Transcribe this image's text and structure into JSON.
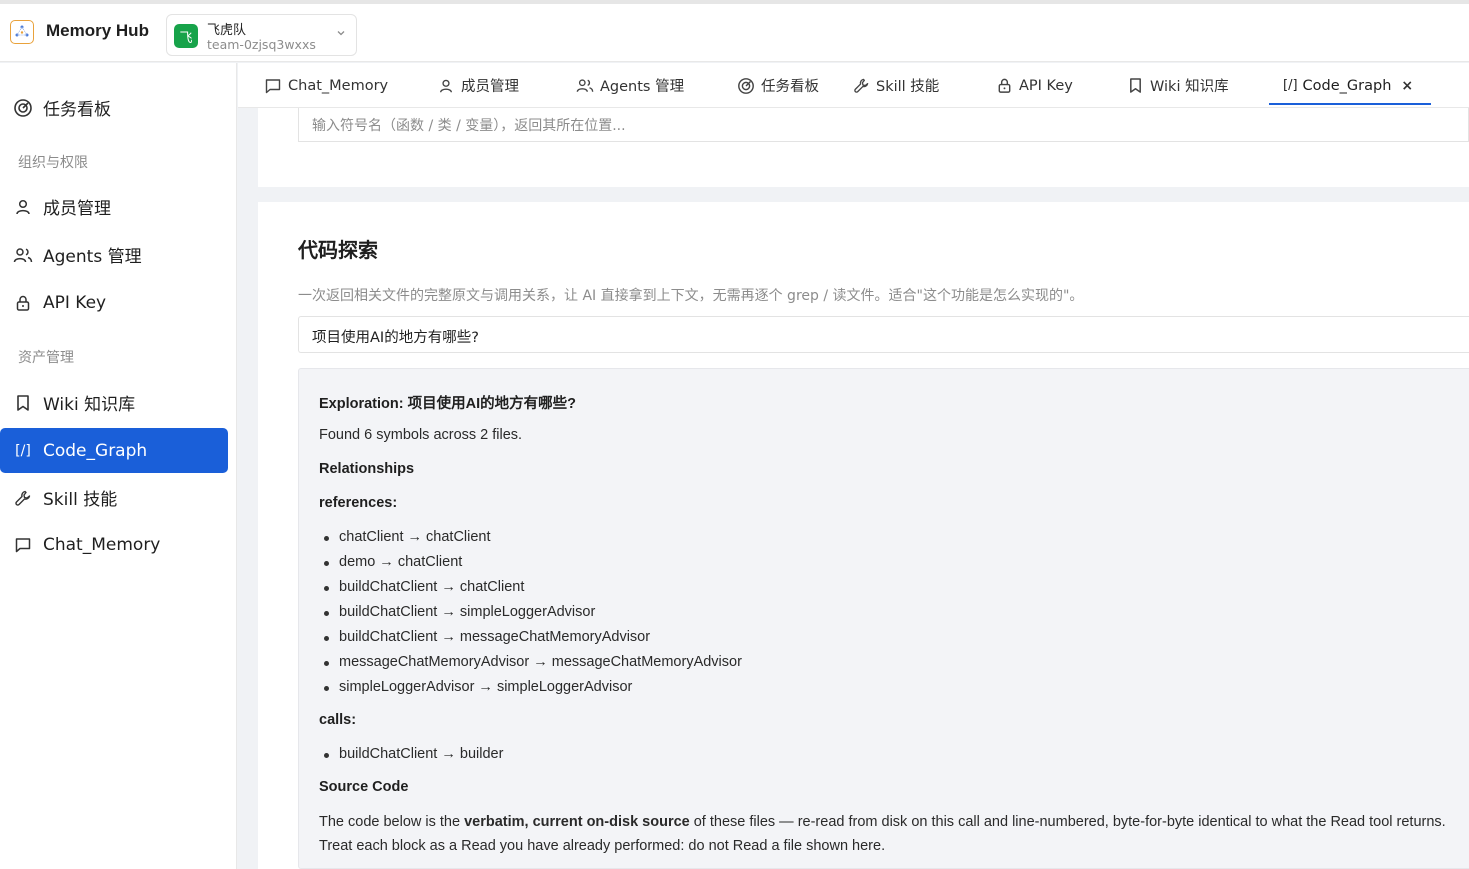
{
  "header": {
    "app_title": "Memory Hub",
    "team": {
      "avatar": "飞",
      "name": "飞虎队",
      "id": "team-0zjsq3wxxs"
    }
  },
  "sidebar": {
    "items": [
      {
        "label": "任务看板",
        "icon": "dashboard-icon"
      },
      {
        "group": "组织与权限"
      },
      {
        "label": "成员管理",
        "icon": "user-icon"
      },
      {
        "label": "Agents 管理",
        "icon": "users-icon"
      },
      {
        "label": "API Key",
        "icon": "lock-icon"
      },
      {
        "group": "资产管理"
      },
      {
        "label": "Wiki 知识库",
        "icon": "bookmark-icon"
      },
      {
        "label": "Code_Graph",
        "icon": "code-icon",
        "active": true
      },
      {
        "label": "Skill 技能",
        "icon": "tool-icon"
      },
      {
        "label": "Chat_Memory",
        "icon": "chat-icon"
      }
    ]
  },
  "tabs": [
    {
      "label": "Chat_Memory",
      "icon": "chat-icon"
    },
    {
      "label": "成员管理",
      "icon": "user-icon"
    },
    {
      "label": "Agents 管理",
      "icon": "users-icon"
    },
    {
      "label": "任务看板",
      "icon": "dashboard-icon"
    },
    {
      "label": "Skill 技能",
      "icon": "tool-icon"
    },
    {
      "label": "API Key",
      "icon": "lock-icon"
    },
    {
      "label": "Wiki 知识库",
      "icon": "bookmark-icon"
    },
    {
      "label": "Code_Graph",
      "icon": "code-icon",
      "active": true,
      "close": "×"
    }
  ],
  "symbol_search": {
    "placeholder": "输入符号名（函数 / 类 / 变量），返回其所在位置..."
  },
  "explore": {
    "title": "代码探索",
    "description": "一次返回相关文件的完整原文与调用关系，让 AI 直接拿到上下文，无需再逐个 grep / 读文件。适合\"这个功能是怎么实现的\"。",
    "query": "项目使用AI的地方有哪些?"
  },
  "result": {
    "heading": "Exploration: 项目使用AI的地方有哪些?",
    "summary": "Found 6 symbols across 2 files.",
    "relationships_label": "Relationships",
    "references_label": "references:",
    "references": [
      "chatClient → chatClient",
      "demo → chatClient",
      "buildChatClient → chatClient",
      "buildChatClient → simpleLoggerAdvisor",
      "buildChatClient → messageChatMemoryAdvisor",
      "messageChatMemoryAdvisor → messageChatMemoryAdvisor",
      "simpleLoggerAdvisor → simpleLoggerAdvisor"
    ],
    "calls_label": "calls:",
    "calls": [
      "buildChatClient → builder"
    ],
    "source_label": "Source Code",
    "source_text_pre": "The code below is the ",
    "source_text_bold": "verbatim, current on-disk source",
    "source_text_post": " of these files — re-read from disk on this call and line-numbered, byte-for-byte identical to what the Read tool returns.",
    "source_text_line2": "Treat each block as a Read you have already performed: do not Read a file shown here."
  }
}
